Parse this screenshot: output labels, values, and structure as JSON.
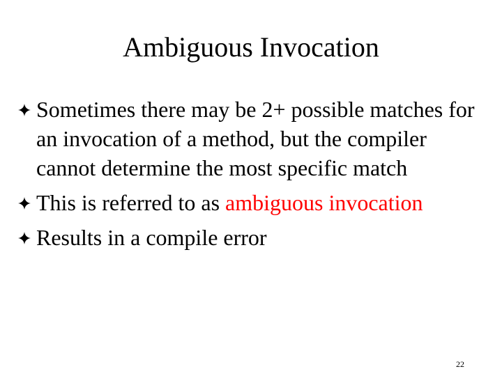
{
  "slide": {
    "title": "Ambiguous Invocation",
    "bullets": [
      {
        "icon": "four-point-star-bullet-icon",
        "text": "Sometimes there may be 2+ possible matches for an invocation of a method, but the compiler cannot determine the most specific match"
      },
      {
        "icon": "four-point-star-bullet-icon",
        "text_prefix": "This is referred to as ",
        "highlight": "ambiguous invocation"
      },
      {
        "icon": "four-point-star-bullet-icon",
        "text": "Results in a compile error"
      }
    ],
    "page_number": "22"
  },
  "colors": {
    "text": "#000000",
    "highlight": "#ff0000",
    "background": "#ffffff"
  }
}
